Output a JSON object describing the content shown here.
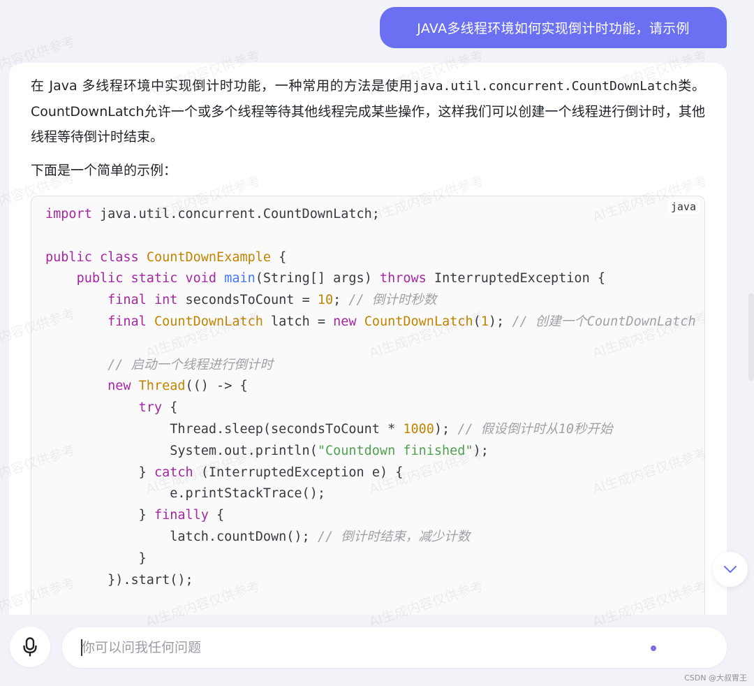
{
  "user_message": "JAVA多线程环境如何实现倒计时功能，请示例",
  "answer": {
    "para1_a": "在 Java 多线程环境中实现倒计时功能，一种常用的方法是使用",
    "para1_code": "java.util.concurrent.CountDownLatch",
    "para1_b": "类。CountDownLatch允许一个或多个线程等待其他线程完成某些操作，这样我们可以创建一个线程进行倒计时，其他线程等待倒计时结束。",
    "intro": "下面是一个简单的示例："
  },
  "code": {
    "language": "java",
    "lines": [
      [
        {
          "t": "import",
          "c": "k"
        },
        {
          "t": " java.util.concurrent.CountDownLatch;"
        }
      ],
      [],
      [
        {
          "t": "public",
          "c": "k"
        },
        {
          "t": " "
        },
        {
          "t": "class",
          "c": "k"
        },
        {
          "t": " "
        },
        {
          "t": "CountDownExample",
          "c": "c"
        },
        {
          "t": " {"
        }
      ],
      [
        {
          "t": "    "
        },
        {
          "t": "public",
          "c": "k"
        },
        {
          "t": " "
        },
        {
          "t": "static",
          "c": "k"
        },
        {
          "t": " "
        },
        {
          "t": "void",
          "c": "k"
        },
        {
          "t": " "
        },
        {
          "t": "main",
          "c": "f"
        },
        {
          "t": "(String[] args) "
        },
        {
          "t": "throws",
          "c": "k"
        },
        {
          "t": " InterruptedException {"
        }
      ],
      [
        {
          "t": "        "
        },
        {
          "t": "final",
          "c": "k"
        },
        {
          "t": " "
        },
        {
          "t": "int",
          "c": "k"
        },
        {
          "t": " secondsToCount = "
        },
        {
          "t": "10",
          "c": "n"
        },
        {
          "t": "; "
        },
        {
          "t": "// 倒计时秒数",
          "c": "cm"
        }
      ],
      [
        {
          "t": "        "
        },
        {
          "t": "final",
          "c": "k"
        },
        {
          "t": " "
        },
        {
          "t": "CountDownLatch",
          "c": "c"
        },
        {
          "t": " latch = "
        },
        {
          "t": "new",
          "c": "k"
        },
        {
          "t": " "
        },
        {
          "t": "CountDownLatch",
          "c": "c"
        },
        {
          "t": "("
        },
        {
          "t": "1",
          "c": "n"
        },
        {
          "t": "); "
        },
        {
          "t": "// 创建一个CountDownLatch",
          "c": "cm"
        }
      ],
      [],
      [
        {
          "t": "        "
        },
        {
          "t": "// 启动一个线程进行倒计时",
          "c": "cm"
        }
      ],
      [
        {
          "t": "        "
        },
        {
          "t": "new",
          "c": "k"
        },
        {
          "t": " "
        },
        {
          "t": "Thread",
          "c": "c"
        },
        {
          "t": "(() -> {"
        }
      ],
      [
        {
          "t": "            "
        },
        {
          "t": "try",
          "c": "k"
        },
        {
          "t": " {"
        }
      ],
      [
        {
          "t": "                Thread.sleep(secondsToCount * "
        },
        {
          "t": "1000",
          "c": "n"
        },
        {
          "t": "); "
        },
        {
          "t": "// 假设倒计时从10秒开始",
          "c": "cm"
        }
      ],
      [
        {
          "t": "                System.out.println("
        },
        {
          "t": "\"Countdown finished\"",
          "c": "s"
        },
        {
          "t": ");"
        }
      ],
      [
        {
          "t": "            } "
        },
        {
          "t": "catch",
          "c": "k"
        },
        {
          "t": " (InterruptedException e) {"
        }
      ],
      [
        {
          "t": "                e.printStackTrace();"
        }
      ],
      [
        {
          "t": "            } "
        },
        {
          "t": "finally",
          "c": "k"
        },
        {
          "t": " {"
        }
      ],
      [
        {
          "t": "                latch.countDown(); "
        },
        {
          "t": "// 倒计时结束，减少计数",
          "c": "cm"
        }
      ],
      [
        {
          "t": "            }"
        }
      ],
      [
        {
          "t": "        }).start();"
        }
      ]
    ]
  },
  "input": {
    "placeholder": "你可以问我任何问题",
    "value": ""
  },
  "watermark": "AI生成内容仅供参考",
  "footer_credit": "CSDN @大叔胃王",
  "icons": {
    "mic": "microphone-icon",
    "scroll": "chevron-down-icon",
    "send": "send-dot-icon"
  },
  "colors": {
    "accent": "#6b6ff2",
    "background": "#f2f3f8"
  }
}
